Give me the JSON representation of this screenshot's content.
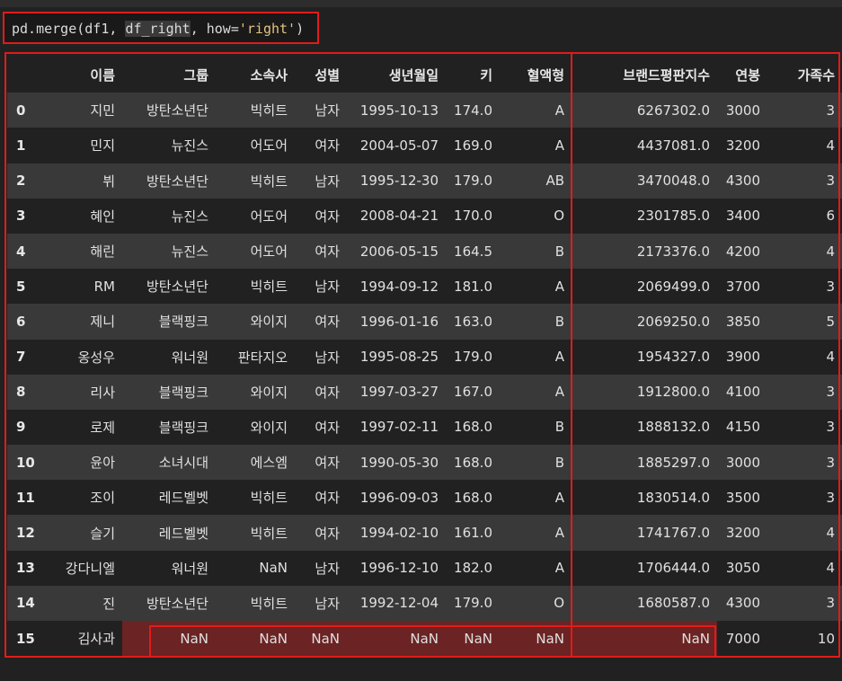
{
  "code": {
    "prefix": "pd.merge(df1, ",
    "arg": "df_right",
    "middle": ", how=",
    "str": "'right'",
    "suffix": ")"
  },
  "table": {
    "columns": [
      "이름",
      "그룹",
      "소속사",
      "성별",
      "생년월일",
      "키",
      "혈액형",
      "브랜드평판지수",
      "연봉",
      "가족수"
    ],
    "rows": [
      {
        "index": "0",
        "cells": [
          "지민",
          "방탄소년단",
          "빅히트",
          "남자",
          "1995-10-13",
          "174.0",
          "A",
          "6267302.0",
          "3000",
          "3"
        ]
      },
      {
        "index": "1",
        "cells": [
          "민지",
          "뉴진스",
          "어도어",
          "여자",
          "2004-05-07",
          "169.0",
          "A",
          "4437081.0",
          "3200",
          "4"
        ]
      },
      {
        "index": "2",
        "cells": [
          "뷔",
          "방탄소년단",
          "빅히트",
          "남자",
          "1995-12-30",
          "179.0",
          "AB",
          "3470048.0",
          "4300",
          "3"
        ]
      },
      {
        "index": "3",
        "cells": [
          "혜인",
          "뉴진스",
          "어도어",
          "여자",
          "2008-04-21",
          "170.0",
          "O",
          "2301785.0",
          "3400",
          "6"
        ]
      },
      {
        "index": "4",
        "cells": [
          "해린",
          "뉴진스",
          "어도어",
          "여자",
          "2006-05-15",
          "164.5",
          "B",
          "2173376.0",
          "4200",
          "4"
        ]
      },
      {
        "index": "5",
        "cells": [
          "RM",
          "방탄소년단",
          "빅히트",
          "남자",
          "1994-09-12",
          "181.0",
          "A",
          "2069499.0",
          "3700",
          "3"
        ]
      },
      {
        "index": "6",
        "cells": [
          "제니",
          "블랙핑크",
          "와이지",
          "여자",
          "1996-01-16",
          "163.0",
          "B",
          "2069250.0",
          "3850",
          "5"
        ]
      },
      {
        "index": "7",
        "cells": [
          "옹성우",
          "워너원",
          "판타지오",
          "남자",
          "1995-08-25",
          "179.0",
          "A",
          "1954327.0",
          "3900",
          "4"
        ]
      },
      {
        "index": "8",
        "cells": [
          "리사",
          "블랙핑크",
          "와이지",
          "여자",
          "1997-03-27",
          "167.0",
          "A",
          "1912800.0",
          "4100",
          "3"
        ]
      },
      {
        "index": "9",
        "cells": [
          "로제",
          "블랙핑크",
          "와이지",
          "여자",
          "1997-02-11",
          "168.0",
          "B",
          "1888132.0",
          "4150",
          "3"
        ]
      },
      {
        "index": "10",
        "cells": [
          "윤아",
          "소녀시대",
          "에스엠",
          "여자",
          "1990-05-30",
          "168.0",
          "B",
          "1885297.0",
          "3000",
          "3"
        ]
      },
      {
        "index": "11",
        "cells": [
          "조이",
          "레드벨벳",
          "빅히트",
          "여자",
          "1996-09-03",
          "168.0",
          "A",
          "1830514.0",
          "3500",
          "3"
        ]
      },
      {
        "index": "12",
        "cells": [
          "슬기",
          "레드벨벳",
          "빅히트",
          "여자",
          "1994-02-10",
          "161.0",
          "A",
          "1741767.0",
          "3200",
          "4"
        ]
      },
      {
        "index": "13",
        "cells": [
          "강다니엘",
          "워너원",
          "NaN",
          "남자",
          "1996-12-10",
          "182.0",
          "A",
          "1706444.0",
          "3050",
          "4"
        ]
      },
      {
        "index": "14",
        "cells": [
          "진",
          "방탄소년단",
          "빅히트",
          "남자",
          "1992-12-04",
          "179.0",
          "O",
          "1680587.0",
          "4300",
          "3"
        ]
      },
      {
        "index": "15",
        "cells": [
          "김사과",
          "NaN",
          "NaN",
          "NaN",
          "NaN",
          "NaN",
          "NaN",
          "NaN",
          "7000",
          "10"
        ]
      }
    ]
  },
  "colors": {
    "highlight_border": "#e11b1b",
    "nan_highlight": "#6b2323",
    "string_literal": "#e3c47d"
  }
}
